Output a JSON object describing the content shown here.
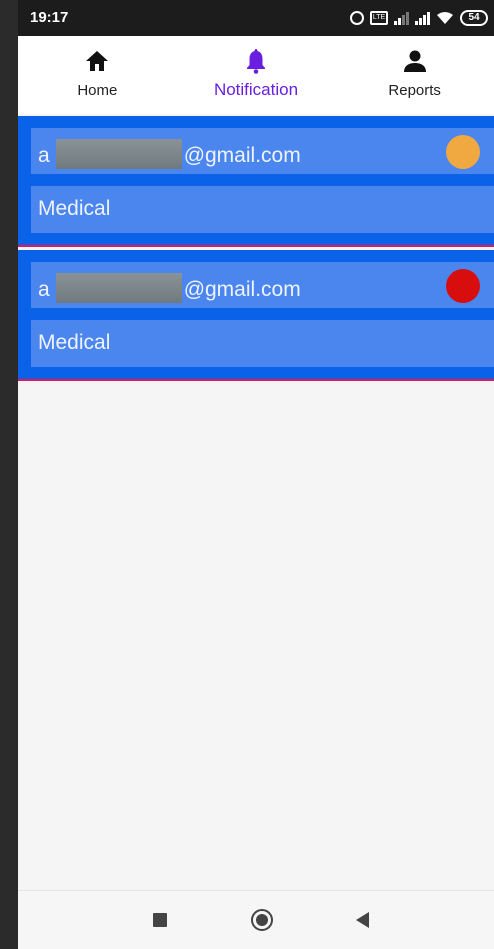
{
  "status_bar": {
    "time": "19:17",
    "battery": "54",
    "volte": "LTE",
    "icons": [
      "alarm-icon",
      "volte-icon",
      "signal-icon",
      "signal-icon",
      "wifi-icon",
      "battery-icon"
    ]
  },
  "tabs": [
    {
      "label": "Home",
      "icon": "home-icon",
      "active": false
    },
    {
      "label": "Notification",
      "icon": "bell-icon",
      "active": true
    },
    {
      "label": "Reports",
      "icon": "person-icon",
      "active": false
    }
  ],
  "notifications": [
    {
      "email_prefix": "a",
      "email_suffix": "@gmail.com",
      "category": "Medical",
      "status_color": "#f0a941"
    },
    {
      "email_prefix": "a",
      "email_suffix": "@gmail.com",
      "category": "Medical",
      "status_color": "#d80d0d"
    }
  ],
  "colors": {
    "accent": "#6a1ee0",
    "card_bg": "#0a62e9",
    "row_bg": "#4b86ee",
    "divider": "#e3185c"
  },
  "navbar": {
    "icons": [
      "recents-icon",
      "home-circle-icon",
      "back-icon"
    ]
  }
}
